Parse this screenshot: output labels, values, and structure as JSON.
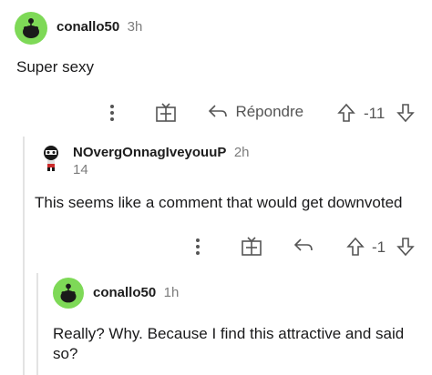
{
  "comments": [
    {
      "username": "conallo50",
      "time": "3h",
      "text": "Super sexy",
      "actions": {
        "reply_label": "Répondre",
        "score": "-11"
      }
    },
    {
      "username": "NOvergOnnagIveyouuP",
      "time": "2h",
      "flair": "14",
      "text": "This seems like a comment that would get downvoted",
      "actions": {
        "score": "-1"
      }
    },
    {
      "username": "conallo50",
      "time": "1h",
      "text": "Really? Why. Because I find this attractive and said so?"
    }
  ],
  "colors": {
    "snoo_green": "#7ed957",
    "icon_gray": "#878a8c"
  },
  "icons": [
    "more-vertical-icon",
    "gift-icon",
    "reply-arrow-icon",
    "upvote-icon",
    "downvote-icon"
  ]
}
